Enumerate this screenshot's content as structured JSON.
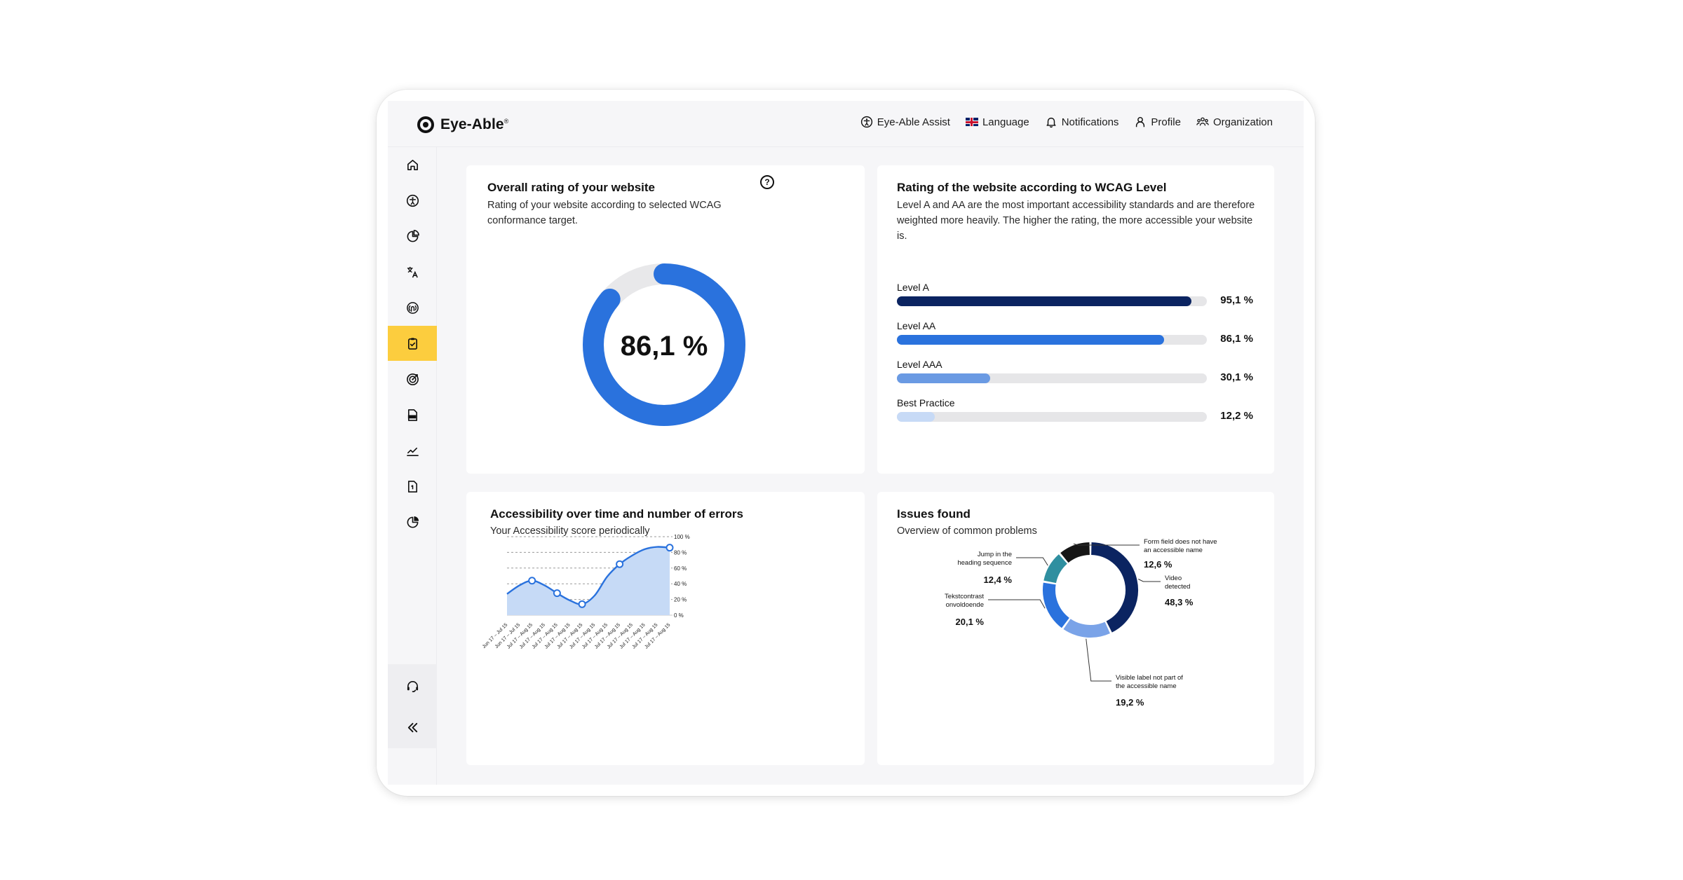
{
  "app": {
    "logo_text": "Eye-Able"
  },
  "nav": {
    "items": [
      {
        "label": "Eye-Able Assist",
        "icon": "accessibility-icon"
      },
      {
        "label": "Language",
        "icon": "uk-flag-icon"
      },
      {
        "label": "Notifications",
        "icon": "bell-icon"
      },
      {
        "label": "Profile",
        "icon": "user-icon"
      },
      {
        "label": "Organization",
        "icon": "group-icon"
      }
    ]
  },
  "sidebar": {
    "items": [
      {
        "icon": "home-icon"
      },
      {
        "icon": "accessibility-icon"
      },
      {
        "icon": "pie-chart-icon"
      },
      {
        "icon": "translate-icon"
      },
      {
        "icon": "fingerprint-icon"
      },
      {
        "icon": "clipboard-check-icon",
        "active": true
      },
      {
        "icon": "target-icon"
      },
      {
        "icon": "pdf-icon"
      },
      {
        "icon": "line-chart-icon"
      },
      {
        "icon": "document-icon"
      },
      {
        "icon": "pie-chart-icon"
      }
    ],
    "bottom_items": [
      {
        "icon": "support-icon"
      },
      {
        "icon": "collapse-icon"
      }
    ],
    "accent_color": "#fccd3e"
  },
  "overall": {
    "title": "Overall rating of your website",
    "subtitle": "Rating of your website according to selected WCAG conformance target.",
    "score_text": "86,1 %",
    "score": 86.1,
    "help_icon": "question-icon"
  },
  "wcag": {
    "title": "Rating of the website according to WCAG Level",
    "subtitle": "Level A and AA are the most important accessibility standards and are therefore weighted more heavily. The higher the rating, the more accessible your website is.",
    "levels": [
      {
        "label": "Level A",
        "value_text": "95,1 %",
        "value": 95.1,
        "color": "#0b2461"
      },
      {
        "label": "Level AA",
        "value_text": "86,1 %",
        "value": 86.1,
        "color": "#2a72dd"
      },
      {
        "label": "Level AAA",
        "value_text": "30,1 %",
        "value": 30.1,
        "color": "#6a9ae3"
      },
      {
        "label": "Best Practice",
        "value_text": "12,2 %",
        "value": 12.2,
        "color": "#c7daf6"
      }
    ]
  },
  "timeline": {
    "title": "Accessibility over time and number of errors",
    "subtitle": "Your Accessibility score periodically"
  },
  "issues": {
    "title": "Issues found",
    "subtitle": "Overview of common problems"
  },
  "chart_data": [
    {
      "type": "area",
      "title": "Accessibility over time and number of errors",
      "y_ticks": [
        "100 %",
        "80 %",
        "60 %",
        "40 %",
        "20 %",
        "0 %"
      ],
      "ylim": [
        0,
        100
      ],
      "categories": [
        "Jun 17 – Jul 15",
        "Jun 17 – Jul 15",
        "Jul 17 – Aug 15",
        "Jul 17 – Aug 15",
        "Jul 17 – Aug 15",
        "Jul 17 – Aug 15",
        "Jul 17 – Aug 15",
        "Jul 17 – Aug 15",
        "Jul 17 – Aug 15",
        "Jul 17 – Aug 15",
        "Jul 17 – Aug 15",
        "Jul 17 – Aug 15",
        "Jul 17 – Aug 15",
        "Jul 17 – Aug 15"
      ],
      "x": [
        0,
        1,
        2,
        3,
        4,
        5,
        6,
        7,
        8,
        9,
        10,
        11,
        12,
        13
      ],
      "values": [
        27,
        38,
        44,
        38,
        28,
        19,
        14,
        25,
        49,
        65,
        76,
        84,
        87,
        86
      ],
      "marked_points": [
        2,
        4,
        6,
        9,
        13
      ],
      "grid": true,
      "line_color": "#2a72dd",
      "fill_color": "#c6daf6"
    },
    {
      "type": "pie",
      "title": "Issues found",
      "slices": [
        {
          "label": "Video detected",
          "value_text": "48,3 %",
          "value": 48.3,
          "color": "#0b2461"
        },
        {
          "label": "Visible label not part of the accessible name",
          "value_text": "19,2 %",
          "value": 19.2,
          "color": "#7aa3e8"
        },
        {
          "label": "Tekstcontrast onvoldoende",
          "value_text": "20,1 %",
          "value": 20.1,
          "color": "#2a72dd"
        },
        {
          "label": "Jump in the heading sequence",
          "value_text": "12,4 %",
          "value": 12.4,
          "color": "#2f8fa0"
        },
        {
          "label": "Form field does not have an accessible name",
          "value_text": "12,6 %",
          "value": 12.6,
          "color": "#161616"
        }
      ]
    }
  ]
}
